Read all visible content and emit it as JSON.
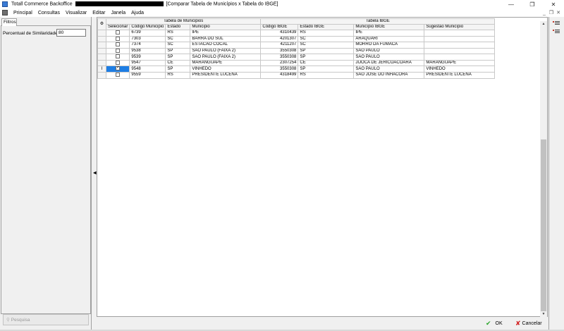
{
  "window": {
    "title_prefix": "Totall Commerce Backoffice",
    "title_suffix": "[Comparar Tabela de Municípios x Tabela do IBGE]",
    "controls": [
      "—",
      "❐",
      "✕"
    ]
  },
  "menu": {
    "items": [
      "Principal",
      "Consultas",
      "Visualizar",
      "Editar",
      "Janela",
      "Ajuda"
    ],
    "mdi_controls": [
      "_",
      "❐",
      "✕"
    ]
  },
  "left_panel": {
    "tab_label": "Filtros",
    "similarity_label": "Percentual de Similaridade:",
    "similarity_value": "80",
    "search_button": "Pesquisa"
  },
  "grid": {
    "group_headers": [
      "Tabela de Municipios",
      "Tabela IBGE"
    ],
    "columns": [
      "Selecionar",
      "Código Municipio",
      "Estado",
      "Municipio",
      "Código IBGE",
      "Estado IBGE",
      "Município IBGE",
      "Sugestão Município"
    ],
    "rows": [
      {
        "indicator": "",
        "checked": false,
        "codigo": "6739",
        "estado": "RS",
        "municipio": "IPE",
        "codigo_ibge": "4310439",
        "estado_ibge": "RS",
        "municipio_ibge": "IPE",
        "sugestao": ""
      },
      {
        "indicator": "",
        "checked": false,
        "codigo": "7303",
        "estado": "SC",
        "municipio": "BARRA DO SUL",
        "codigo_ibge": "4201307",
        "estado_ibge": "SC",
        "municipio_ibge": "ARAQUARI",
        "sugestao": ""
      },
      {
        "indicator": "",
        "checked": false,
        "codigo": "7374",
        "estado": "SC",
        "municipio": "ESTACAO COCAL",
        "codigo_ibge": "4211207",
        "estado_ibge": "SC",
        "municipio_ibge": "MORRO DA FUMACA",
        "sugestao": ""
      },
      {
        "indicator": "",
        "checked": false,
        "codigo": "9538",
        "estado": "SP",
        "municipio": "SAO PAULO (FAIXA 2)",
        "codigo_ibge": "3550308",
        "estado_ibge": "SP",
        "municipio_ibge": "SAO PAULO",
        "sugestao": ""
      },
      {
        "indicator": "",
        "checked": false,
        "codigo": "9539",
        "estado": "SP",
        "municipio": "SAO PAULO (FAIXA 2)",
        "codigo_ibge": "3550308",
        "estado_ibge": "SP",
        "municipio_ibge": "SAO PAULO",
        "sugestao": ""
      },
      {
        "indicator": "",
        "checked": false,
        "codigo": "9547",
        "estado": "CE",
        "municipio": "MARANGUAPE",
        "codigo_ibge": "2307254",
        "estado_ibge": "CE",
        "municipio_ibge": "JIJOCA DE JERICOACOARA",
        "sugestao": "MARANGUAPE"
      },
      {
        "indicator": "I",
        "checked": true,
        "codigo": "9548",
        "estado": "SP",
        "municipio": "VINHEDO",
        "codigo_ibge": "3550308",
        "estado_ibge": "SP",
        "municipio_ibge": "SAO PAULO",
        "sugestao": "VINHEDO"
      },
      {
        "indicator": "",
        "checked": false,
        "codigo": "9559",
        "estado": "RS",
        "municipio": "PRESIDENTE LUCENA",
        "codigo_ibge": "4318499",
        "estado_ibge": "RS",
        "municipio_ibge": "SAO JOSE DO INHACORA",
        "sugestao": "PRESIDENTE LUCENA"
      }
    ],
    "active_row_index": 6,
    "active_color": "#1e7ee4"
  },
  "bottom": {
    "ok_label": "OK",
    "cancel_label": "Cancelar",
    "ok_icon": "check-icon",
    "cancel_icon": "x-icon",
    "ok_color": "#2aa52a",
    "cancel_color": "#d21e1e"
  }
}
